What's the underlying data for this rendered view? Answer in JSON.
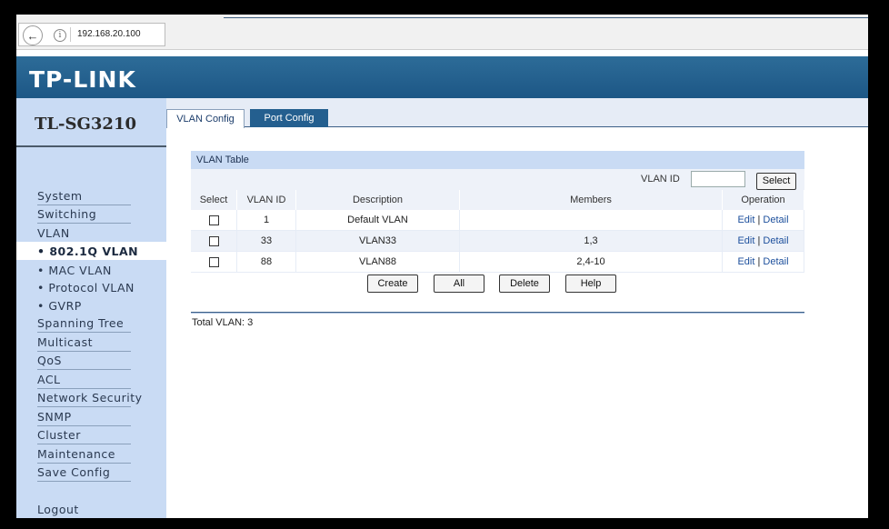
{
  "browser": {
    "url": "192.168.20.100"
  },
  "header": {
    "brand": "TP-LINK",
    "model": "TL-SG3210"
  },
  "sidebar": {
    "items": [
      {
        "label": "System"
      },
      {
        "label": "Switching"
      },
      {
        "label": "VLAN"
      },
      {
        "label": "• 802.1Q VLAN",
        "active": true
      },
      {
        "label": "• MAC VLAN"
      },
      {
        "label": "• Protocol VLAN"
      },
      {
        "label": "• GVRP"
      },
      {
        "label": "Spanning Tree"
      },
      {
        "label": "Multicast"
      },
      {
        "label": "QoS"
      },
      {
        "label": "ACL"
      },
      {
        "label": "Network Security"
      },
      {
        "label": "SNMP"
      },
      {
        "label": "Cluster"
      },
      {
        "label": "Maintenance"
      },
      {
        "label": "Save Config"
      },
      {
        "label": "Logout"
      }
    ]
  },
  "tabs": [
    {
      "label": "VLAN Config",
      "active": true
    },
    {
      "label": "Port Config",
      "active": false
    }
  ],
  "vlan_table": {
    "title": "VLAN Table",
    "search_label": "VLAN ID",
    "search_value": "",
    "select_button": "Select",
    "columns": [
      "Select",
      "VLAN ID",
      "Description",
      "Members",
      "Operation"
    ],
    "rows": [
      {
        "vlan_id": "1",
        "description": "Default VLAN",
        "members": "",
        "edit": "Edit",
        "sep": "|",
        "detail": "Detail"
      },
      {
        "vlan_id": "33",
        "description": "VLAN33",
        "members": "1,3",
        "edit": "Edit",
        "sep": "|",
        "detail": "Detail"
      },
      {
        "vlan_id": "88",
        "description": "VLAN88",
        "members": "2,4-10",
        "edit": "Edit",
        "sep": "|",
        "detail": "Detail"
      }
    ]
  },
  "actions": {
    "create": "Create",
    "all": "All",
    "delete": "Delete",
    "help": "Help"
  },
  "footer": {
    "total": "Total VLAN: 3"
  },
  "colors": {
    "header_blue": "#1d5786",
    "sidebar_bg": "#c9dbf4",
    "active_tab_bg": "#245f8f"
  },
  "icons": {
    "back": "back-arrow-icon",
    "info": "info-icon"
  }
}
